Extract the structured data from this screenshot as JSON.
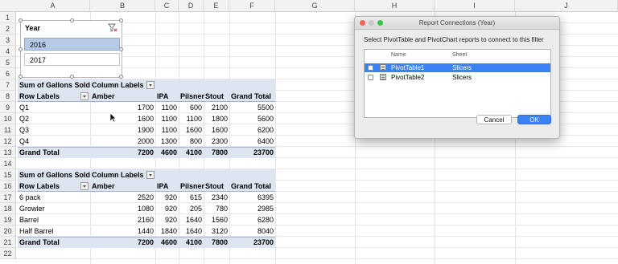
{
  "columns": [
    "A",
    "B",
    "C",
    "D",
    "E",
    "F",
    "G",
    "H",
    "I",
    "J"
  ],
  "rows": [
    "1",
    "2",
    "3",
    "4",
    "5",
    "6",
    "7",
    "8",
    "9",
    "10",
    "11",
    "12",
    "13",
    "14",
    "15",
    "16",
    "17",
    "18",
    "19",
    "20",
    "21",
    "22"
  ],
  "slicer": {
    "title": "Year",
    "clear_icon": "clear-filter-icon",
    "items": [
      {
        "label": "2016",
        "selected": true
      },
      {
        "label": "2017",
        "selected": false
      }
    ],
    "selected_color": "#b7cbe6"
  },
  "pivot1": {
    "header_label": "Sum of Gallons Sold",
    "column_labels": "Column Labels",
    "row_labels": "Row Labels",
    "col_names": [
      "Amber",
      "IPA",
      "Pilsner",
      "Stout",
      "Grand Total"
    ],
    "rows": [
      {
        "label": "Q1",
        "values": [
          "1700",
          "1100",
          "600",
          "2100",
          "5500"
        ]
      },
      {
        "label": "Q2",
        "values": [
          "1600",
          "1100",
          "1100",
          "1800",
          "5600"
        ]
      },
      {
        "label": "Q3",
        "values": [
          "1900",
          "1100",
          "1600",
          "1600",
          "6200"
        ]
      },
      {
        "label": "Q4",
        "values": [
          "2000",
          "1300",
          "800",
          "2300",
          "6400"
        ]
      }
    ],
    "total": {
      "label": "Grand Total",
      "values": [
        "7200",
        "4600",
        "4100",
        "7800",
        "23700"
      ]
    }
  },
  "pivot2": {
    "header_label": "Sum of Gallons Sold",
    "column_labels": "Column Labels",
    "row_labels": "Row Labels",
    "col_names": [
      "Amber",
      "IPA",
      "Pilsner",
      "Stout",
      "Grand Total"
    ],
    "rows": [
      {
        "label": "6 pack",
        "values": [
          "2520",
          "920",
          "615",
          "2340",
          "6395"
        ]
      },
      {
        "label": "Growler",
        "values": [
          "1080",
          "920",
          "205",
          "780",
          "2985"
        ]
      },
      {
        "label": "Barrel",
        "values": [
          "2160",
          "920",
          "1640",
          "1560",
          "6280"
        ]
      },
      {
        "label": "Half Barrel",
        "values": [
          "1440",
          "1840",
          "1640",
          "3120",
          "8040"
        ]
      }
    ],
    "total": {
      "label": "Grand Total",
      "values": [
        "7200",
        "4600",
        "4100",
        "7800",
        "23700"
      ]
    }
  },
  "dialog": {
    "title": "Report Connections (Year)",
    "instruction": "Select PivotTable and PivotChart reports to connect to this filter",
    "col_name": "Name",
    "col_sheet": "Sheet",
    "items": [
      {
        "name": "PivotTable1",
        "sheet": "Slicers",
        "selected": true
      },
      {
        "name": "PivotTable2",
        "sheet": "Slicers",
        "selected": false
      }
    ],
    "cancel_label": "Cancel",
    "ok_label": "OK",
    "accent_color": "#3b82f7"
  },
  "colors": {
    "pivot_band": "#dde5f1",
    "traffic_close": "#fc605b",
    "traffic_min": "#fdbc40",
    "traffic_max": "#34c84a"
  }
}
